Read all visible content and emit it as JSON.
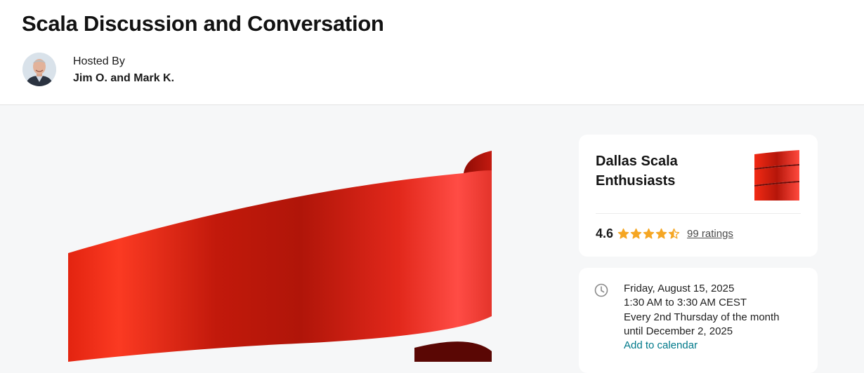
{
  "event": {
    "title": "Scala Discussion and Conversation"
  },
  "host": {
    "label": "Hosted By",
    "names": "Jim O. and Mark K."
  },
  "group": {
    "name": "Dallas Scala Enthusiasts",
    "rating": "4.6",
    "rating_stars": 4.6,
    "ratings_link": "99 ratings"
  },
  "time": {
    "date": "Friday, August 15, 2025",
    "hours": "1:30 AM to 3:30 AM CEST",
    "recurrence": "Every 2nd Thursday of the month",
    "until": "until December 2, 2025",
    "calendar_link": "Add to calendar"
  },
  "icons": {
    "clock": "clock-icon",
    "star": "star-icon",
    "logo": "scala-logo"
  },
  "colors": {
    "star": "#f5a623",
    "link": "#00798a",
    "scala_red": "#de1a0e",
    "background": "#f6f7f8"
  }
}
